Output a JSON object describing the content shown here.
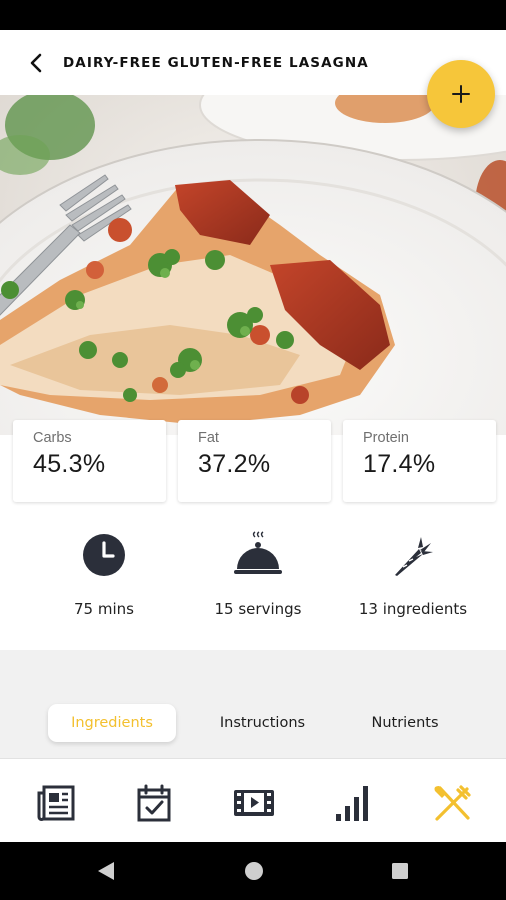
{
  "header": {
    "title": "DAIRY-FREE GLUTEN-FREE LASAGNA",
    "back_icon": "chevron-left-icon",
    "fab_icon": "plus-icon"
  },
  "hero": {
    "image": "lasagna-photo"
  },
  "macros": [
    {
      "label": "Carbs",
      "value": "45.3%"
    },
    {
      "label": "Fat",
      "value": "37.2%"
    },
    {
      "label": "Protein",
      "value": "17.4%"
    }
  ],
  "info": [
    {
      "icon": "clock-icon",
      "label": "75 mins"
    },
    {
      "icon": "serving-dish-icon",
      "label": "15 servings"
    },
    {
      "icon": "carrot-icon",
      "label": "13 ingredients"
    }
  ],
  "tabs": [
    {
      "label": "Ingredients",
      "active": true
    },
    {
      "label": "Instructions",
      "active": false
    },
    {
      "label": "Nutrients",
      "active": false
    }
  ],
  "bottom_nav": [
    {
      "icon": "newspaper-icon"
    },
    {
      "icon": "calendar-check-icon"
    },
    {
      "icon": "video-icon"
    },
    {
      "icon": "bar-chart-icon"
    },
    {
      "icon": "fork-knife-icon",
      "active": true
    }
  ],
  "colors": {
    "accent": "#f6c63a",
    "active_tab_text": "#f3c02f",
    "icon_dark": "#2b2f3a"
  }
}
